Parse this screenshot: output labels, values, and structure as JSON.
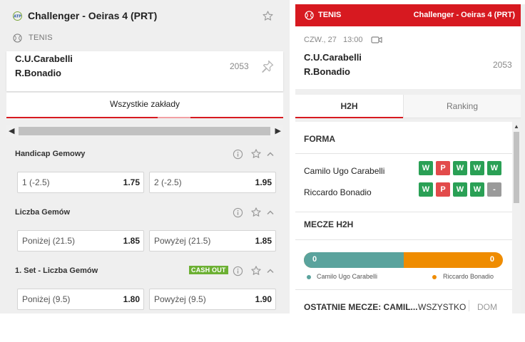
{
  "left": {
    "title": "Challenger - Oeiras 4 (PRT)",
    "sport": "TENIS",
    "match": {
      "player1": "C.U.Carabelli",
      "player2": "R.Bonadio",
      "id": "2053"
    },
    "tab": "Wszystkie zakłady",
    "markets": [
      {
        "label": "Handicap Gemowy",
        "cashout": null,
        "odds": [
          {
            "label": "1 (-2.5)",
            "value": "1.75"
          },
          {
            "label": "2 (-2.5)",
            "value": "1.95"
          }
        ]
      },
      {
        "label": "Liczba Gemów",
        "cashout": null,
        "odds": [
          {
            "label": "Poniżej (21.5)",
            "value": "1.85"
          },
          {
            "label": "Powyżej (21.5)",
            "value": "1.85"
          }
        ]
      },
      {
        "label": "1. Set - Liczba Gemów",
        "cashout": "CASH OUT",
        "odds": [
          {
            "label": "Poniżej (9.5)",
            "value": "1.80"
          },
          {
            "label": "Powyżej (9.5)",
            "value": "1.90"
          }
        ]
      }
    ]
  },
  "right": {
    "sport": "TENIS",
    "title": "Challenger - Oeiras 4 (PRT)",
    "date": "CZW., 27",
    "time": "13:00",
    "match": {
      "player1": "C.U.Carabelli",
      "player2": "R.Bonadio",
      "id": "2053"
    },
    "tabs": {
      "h2h": "H2H",
      "ranking": "Ranking"
    },
    "form": {
      "title": "FORMA",
      "players": [
        {
          "name": "Camilo Ugo Carabelli",
          "results": [
            "W",
            "P",
            "W",
            "W",
            "W"
          ]
        },
        {
          "name": "Riccardo Bonadio",
          "results": [
            "W",
            "P",
            "W",
            "W",
            "-"
          ]
        }
      ]
    },
    "h2h": {
      "title": "MECZE H2H",
      "value1": "0",
      "value2": "0",
      "share1": 0.5,
      "legend1": "Camilo Ugo Carabelli",
      "legend2": "Riccardo Bonadio"
    },
    "last": {
      "title": "OSTATNIE MECZE: CAMIL...",
      "all": "WSZYSTKO",
      "home": "DOM"
    }
  },
  "colors": {
    "accent": "#d71920",
    "win": "#2aa055",
    "loss": "#e24b4b",
    "none": "#9a9a9a",
    "p1": "#5aa39d",
    "p2": "#ef8c00",
    "cashout": "#6cb033"
  }
}
